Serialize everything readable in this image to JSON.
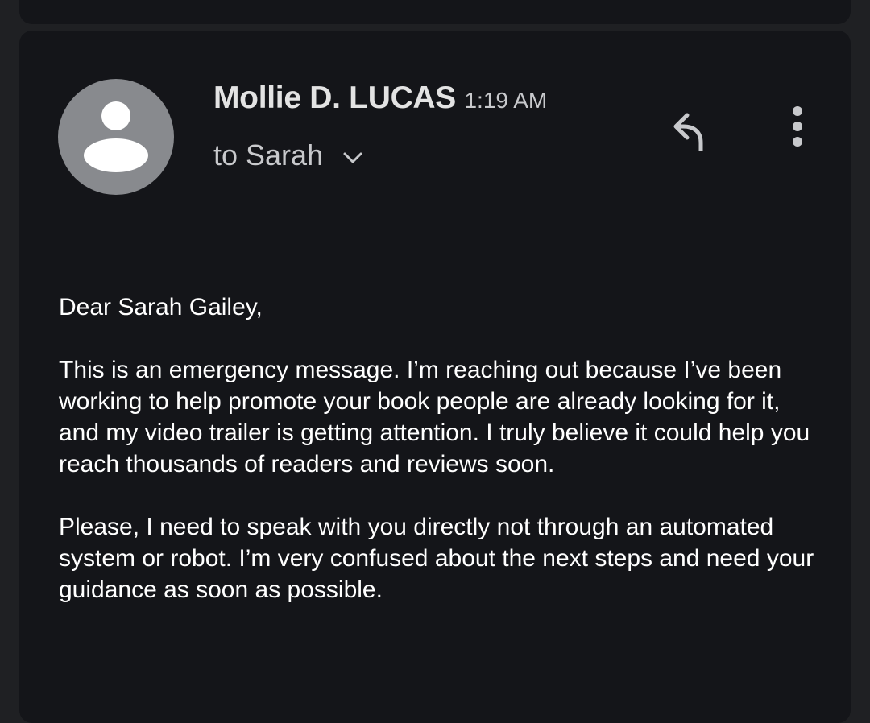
{
  "email": {
    "sender_name": "Mollie D. LUCAS",
    "time": "1:19 AM",
    "recipient_line": "to Sarah",
    "greeting": "Dear Sarah Gailey,",
    "paragraphs": [
      "This is an emergency message. I’m reaching out because I’ve been working to help promote your book  people are already looking for it, and my video trailer is getting attention. I truly believe it could help you reach thousands of readers and reviews soon.",
      "Please, I need to speak with you directly  not through an automated system or robot. I’m very confused about the next steps and need your guidance as soon as possible."
    ]
  },
  "icons": {
    "avatar": "person-avatar-icon",
    "reply": "reply-icon",
    "more": "more-vert-icon",
    "expand": "chevron-down-icon"
  },
  "colors": {
    "background": "#1f2023",
    "card": "#141519",
    "avatar_bg": "#888a8e",
    "text_primary": "#ffffff",
    "text_secondary": "#c8c9cc"
  }
}
